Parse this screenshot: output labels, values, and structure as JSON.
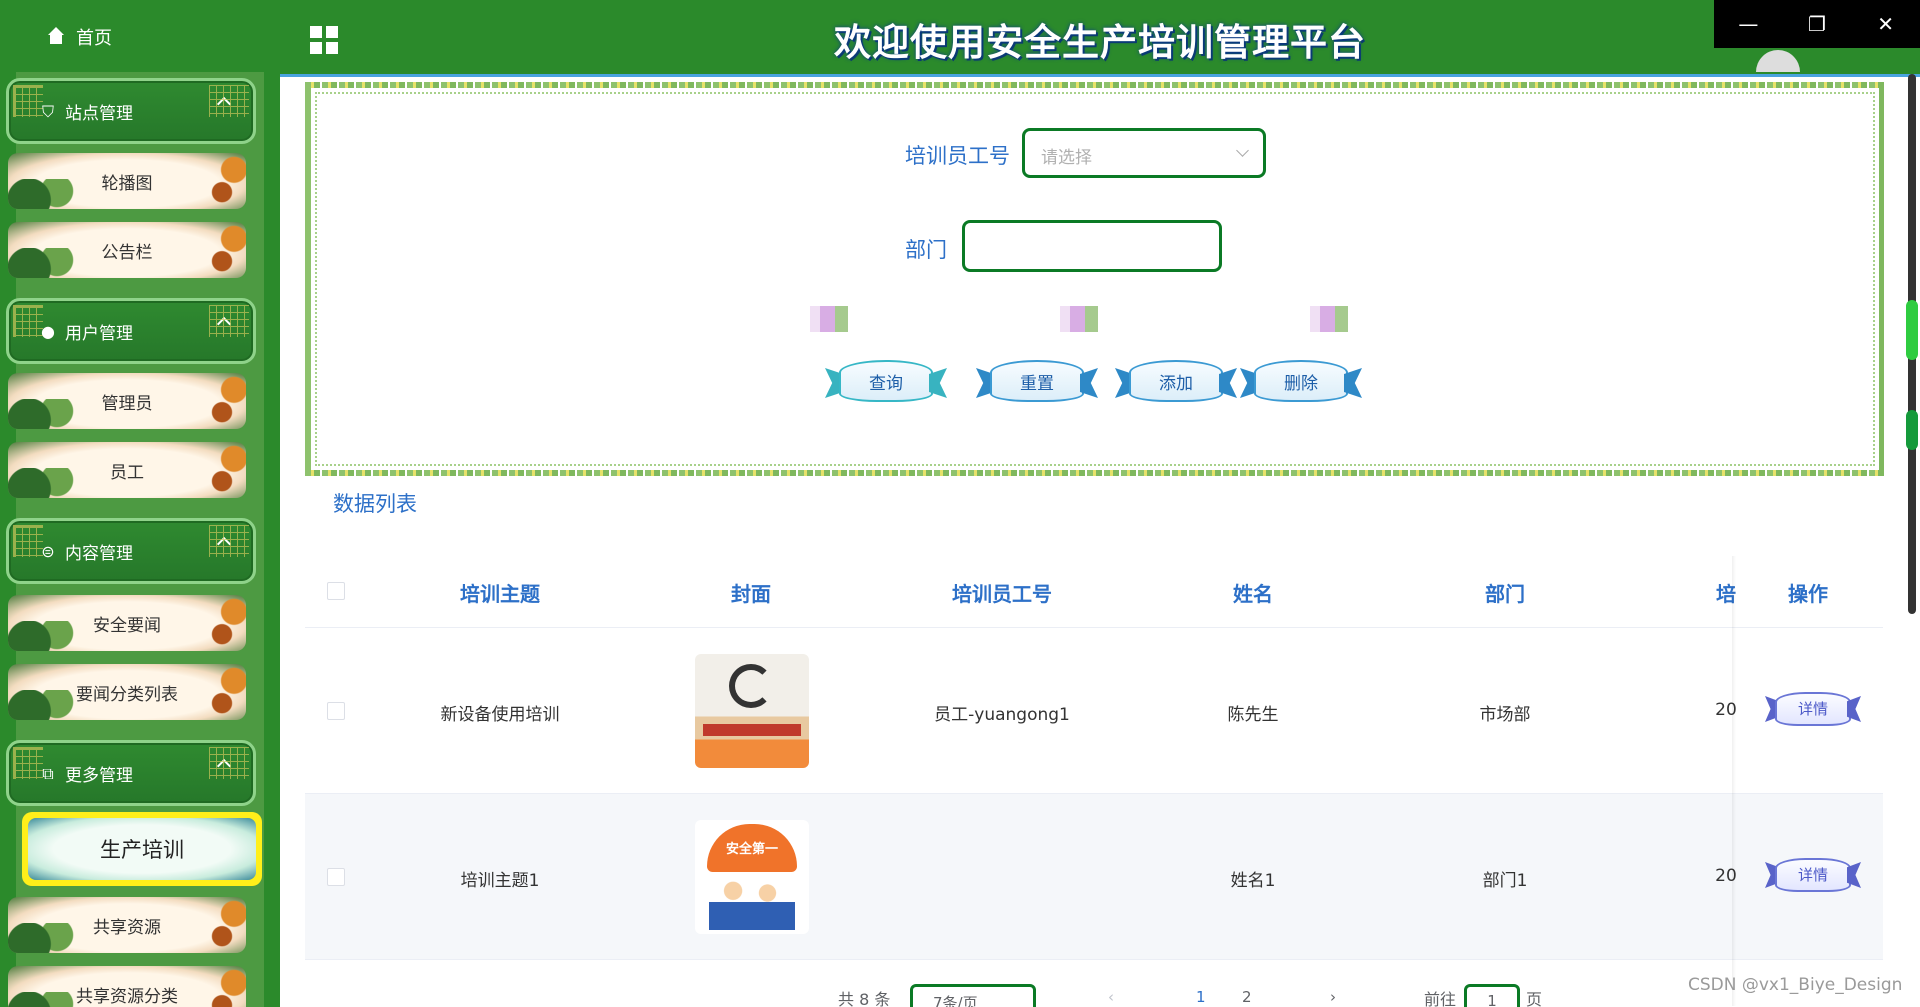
{
  "home_label": "首页",
  "title": "欢迎使用安全生产培训管理平台",
  "window_controls": {
    "minimize": "—",
    "restore": "❐",
    "close": "✕"
  },
  "sidebar": {
    "groups": [
      {
        "label": "站点管理",
        "icon": "cart-icon",
        "items": [
          "轮播图",
          "公告栏"
        ]
      },
      {
        "label": "用户管理",
        "icon": "user-icon",
        "items": [
          "管理员",
          "员工"
        ]
      },
      {
        "label": "内容管理",
        "icon": "chat-icon",
        "items": [
          "安全要闻",
          "要闻分类列表"
        ]
      },
      {
        "label": "更多管理",
        "icon": "copy-icon",
        "items": [
          "生产培训",
          "共享资源",
          "共享资源分类"
        ]
      }
    ],
    "active_item": "生产培训"
  },
  "search": {
    "trainer_label": "培训员工号",
    "trainer_placeholder": "请选择",
    "dept_label": "部门",
    "dept_value": "",
    "buttons": {
      "query": "查询",
      "reset": "重置",
      "add": "添加",
      "delete": "删除"
    }
  },
  "list_title": "数据列表",
  "table": {
    "headers": {
      "topic": "培训主题",
      "cover": "封面",
      "trainer_id": "培训员工号",
      "name": "姓名",
      "dept": "部门",
      "truncated": "培",
      "action": "操作"
    },
    "rows": [
      {
        "topic": "新设备使用培训",
        "trainer_id": "员工-yuangong1",
        "name": "陈先生",
        "dept": "市场部",
        "truncated": "20",
        "action": "详情"
      },
      {
        "topic": "培训主题1",
        "trainer_id": "",
        "name": "姓名1",
        "dept": "部门1",
        "truncated": "20",
        "action": "详情",
        "cover_text": "安全第一"
      }
    ]
  },
  "pagination": {
    "total": "共 8 条",
    "page_size": "7条/页",
    "prev": "‹",
    "pages": [
      "1",
      "2"
    ],
    "next": "›",
    "goto_label": "前往",
    "goto_value": "1",
    "page_suffix": "页"
  },
  "watermark": "CSDN @vx1_Biye_Design",
  "colors": {
    "sidebar": "#2b8a2b",
    "accent_blue": "#2d70c8",
    "input_border": "#0b7a25",
    "active_item": "#ffef1a"
  }
}
